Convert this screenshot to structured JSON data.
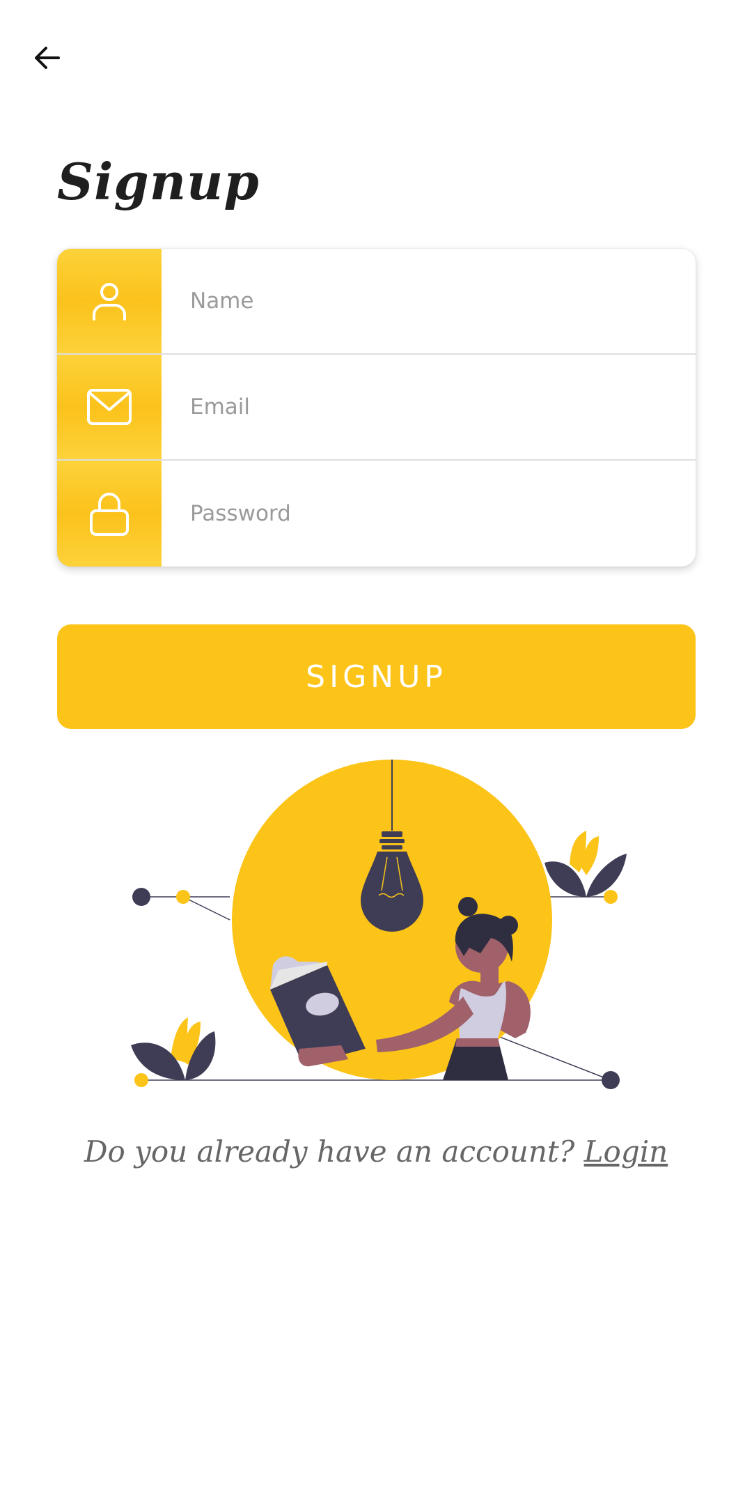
{
  "header": {
    "back_icon": "arrow-left-icon",
    "title": "Signup"
  },
  "form": {
    "fields": [
      {
        "icon": "user-icon",
        "placeholder": "Name"
      },
      {
        "icon": "mail-icon",
        "placeholder": "Email"
      },
      {
        "icon": "lock-icon",
        "placeholder": "Password"
      }
    ],
    "submit_label": "SIGNUP"
  },
  "footer": {
    "prompt": "Do you already have an account?",
    "login_label": "Login"
  },
  "colors": {
    "accent": "#fcc419",
    "dark": "#3f3d56",
    "skin": "#a0616a"
  }
}
